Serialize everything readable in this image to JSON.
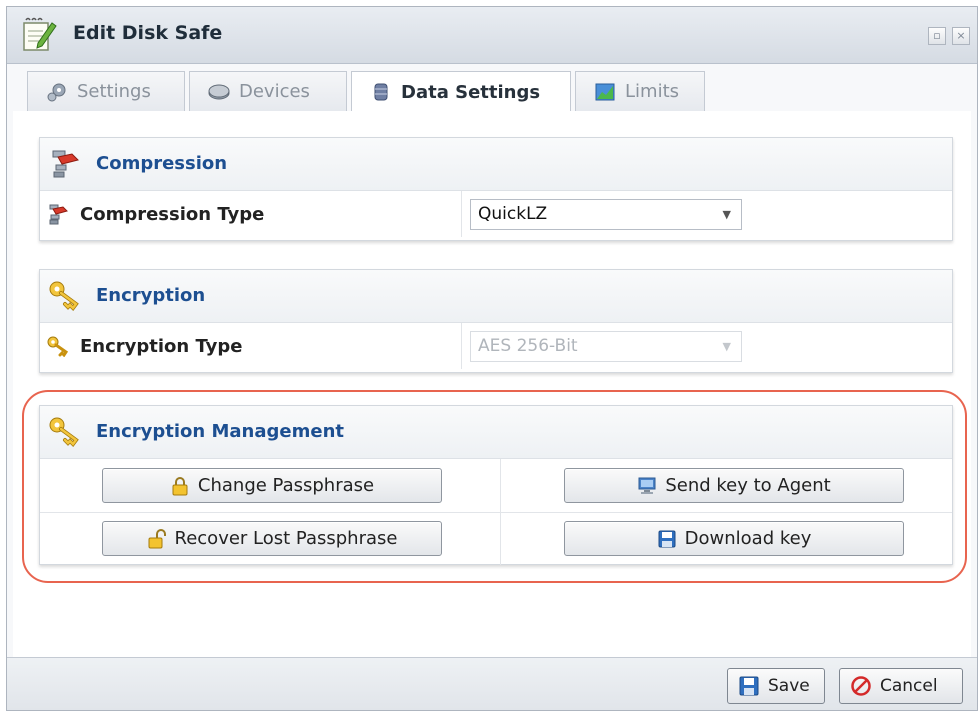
{
  "window": {
    "title": "Edit Disk Safe"
  },
  "tabs": [
    {
      "label": "Settings",
      "icon": "gears-icon",
      "active": false
    },
    {
      "label": "Devices",
      "icon": "disk-icon",
      "active": false
    },
    {
      "label": "Data Settings",
      "icon": "database-icon",
      "active": true
    },
    {
      "label": "Limits",
      "icon": "chart-icon",
      "active": false
    }
  ],
  "compression": {
    "title": "Compression",
    "type_label": "Compression Type",
    "type_value": "QuickLZ"
  },
  "encryption": {
    "title": "Encryption",
    "type_label": "Encryption Type",
    "type_value": "AES 256-Bit"
  },
  "management": {
    "title": "Encryption Management",
    "change_passphrase": "Change Passphrase",
    "recover_passphrase": "Recover Lost Passphrase",
    "send_key": "Send key to Agent",
    "download_key": "Download key"
  },
  "footer": {
    "save_label": "Save",
    "cancel_label": "Cancel"
  },
  "colors": {
    "accent_title": "#1d4f91",
    "highlight": "#e8644f"
  }
}
